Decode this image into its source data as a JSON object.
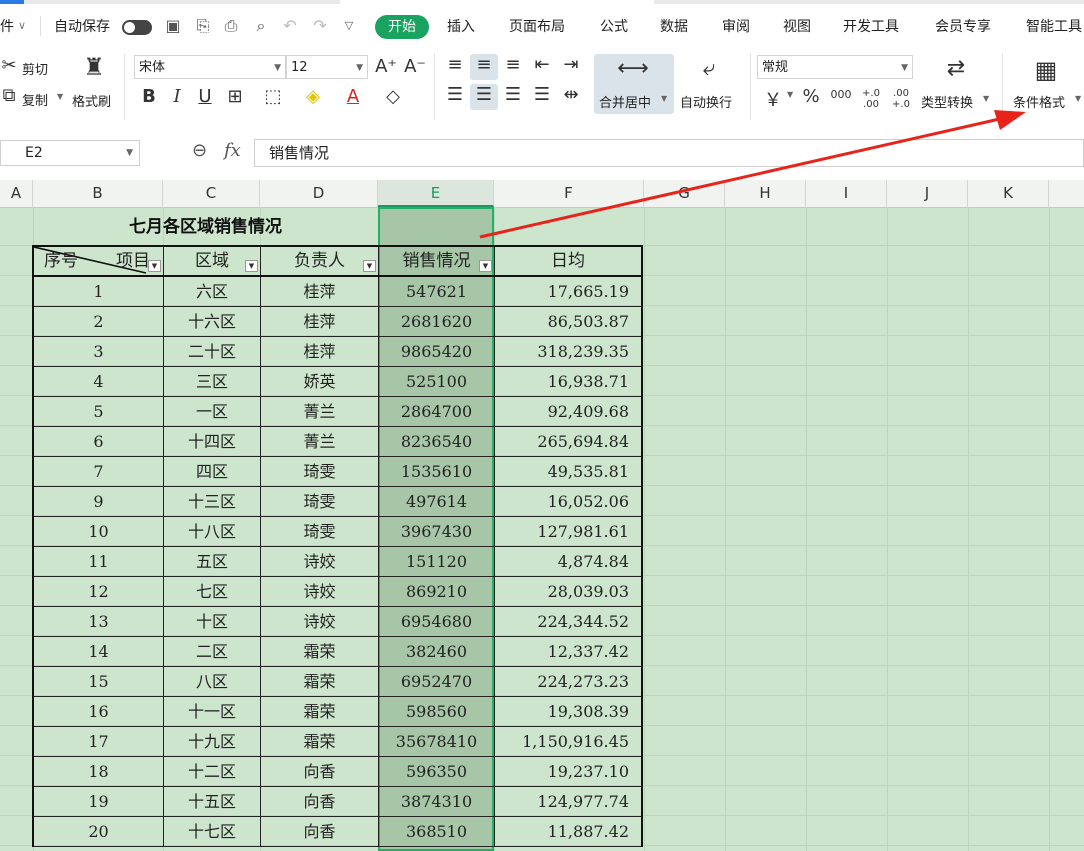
{
  "menubar": {
    "file_fragment": "件",
    "autosave_label": "自动保存",
    "tabs": [
      "开始",
      "插入",
      "页面布局",
      "公式",
      "数据",
      "审阅",
      "视图",
      "开发工具",
      "会员专享",
      "智能工具"
    ]
  },
  "ribbon": {
    "cut_label": "剪切",
    "copy_label": "复制",
    "format_painter_label": "格式刷",
    "font_name": "宋体",
    "font_size": "12",
    "bold": "B",
    "italic": "I",
    "underline": "U",
    "merge_center_label": "合并居中",
    "wrap_text_label": "自动换行",
    "number_format": "常规",
    "type_convert_label": "类型转换",
    "conditional_format_label": "条件格式",
    "yen_symbol": "￥",
    "percent_symbol": "%",
    "thousands_symbol": "000",
    "inc_decimal": "+.0 .00",
    "dec_decimal": ".00 +.0"
  },
  "formula_bar": {
    "name_box": "E2",
    "fx": "fx",
    "content": "销售情况"
  },
  "columns": [
    "A",
    "B",
    "C",
    "D",
    "E",
    "F",
    "G",
    "H",
    "I",
    "J",
    "K"
  ],
  "selected_column": "E",
  "table": {
    "title": "七月各区域销售情况",
    "diag_left": "序号",
    "diag_right": "项目",
    "headers": [
      "区域",
      "负责人",
      "销售情况",
      "日均"
    ],
    "rows": [
      {
        "no": "1",
        "region": "六区",
        "owner": "桂萍",
        "sales": "547621",
        "daily": "17,665.19"
      },
      {
        "no": "2",
        "region": "十六区",
        "owner": "桂萍",
        "sales": "2681620",
        "daily": "86,503.87"
      },
      {
        "no": "3",
        "region": "二十区",
        "owner": "桂萍",
        "sales": "9865420",
        "daily": "318,239.35"
      },
      {
        "no": "4",
        "region": "三区",
        "owner": "娇英",
        "sales": "525100",
        "daily": "16,938.71"
      },
      {
        "no": "5",
        "region": "一区",
        "owner": "菁兰",
        "sales": "2864700",
        "daily": "92,409.68"
      },
      {
        "no": "6",
        "region": "十四区",
        "owner": "菁兰",
        "sales": "8236540",
        "daily": "265,694.84"
      },
      {
        "no": "7",
        "region": "四区",
        "owner": "琦雯",
        "sales": "1535610",
        "daily": "49,535.81"
      },
      {
        "no": "9",
        "region": "十三区",
        "owner": "琦雯",
        "sales": "497614",
        "daily": "16,052.06"
      },
      {
        "no": "10",
        "region": "十八区",
        "owner": "琦雯",
        "sales": "3967430",
        "daily": "127,981.61"
      },
      {
        "no": "11",
        "region": "五区",
        "owner": "诗姣",
        "sales": "151120",
        "daily": "4,874.84"
      },
      {
        "no": "12",
        "region": "七区",
        "owner": "诗姣",
        "sales": "869210",
        "daily": "28,039.03"
      },
      {
        "no": "13",
        "region": "十区",
        "owner": "诗姣",
        "sales": "6954680",
        "daily": "224,344.52"
      },
      {
        "no": "14",
        "region": "二区",
        "owner": "霜荣",
        "sales": "382460",
        "daily": "12,337.42"
      },
      {
        "no": "15",
        "region": "八区",
        "owner": "霜荣",
        "sales": "6952470",
        "daily": "224,273.23"
      },
      {
        "no": "16",
        "region": "十一区",
        "owner": "霜荣",
        "sales": "598560",
        "daily": "19,308.39"
      },
      {
        "no": "17",
        "region": "十九区",
        "owner": "霜荣",
        "sales": "35678410",
        "daily": "1,150,916.45"
      },
      {
        "no": "18",
        "region": "十二区",
        "owner": "向香",
        "sales": "596350",
        "daily": "19,237.10"
      },
      {
        "no": "19",
        "region": "十五区",
        "owner": "向香",
        "sales": "3874310",
        "daily": "124,977.74"
      },
      {
        "no": "20",
        "region": "十七区",
        "owner": "向香",
        "sales": "368510",
        "daily": "11,887.42"
      }
    ]
  },
  "colors": {
    "accent": "#1aa260",
    "sheet_bg": "#cce5cc",
    "selected_col": "#a7c6a7",
    "annotation_arrow": "#e8231a"
  }
}
